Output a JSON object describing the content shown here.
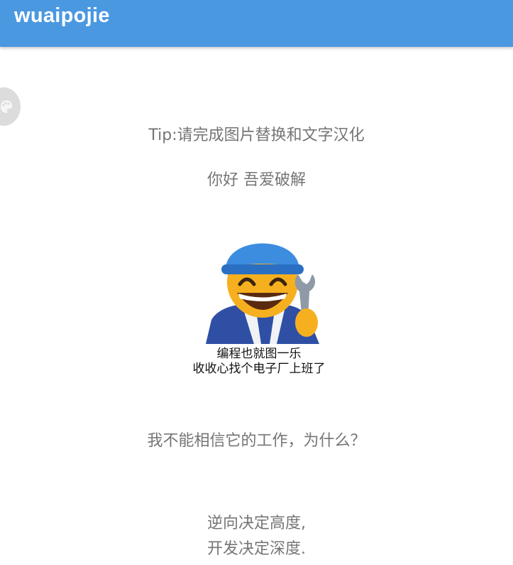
{
  "app_bar": {
    "title": "wuaipojie",
    "color": "#4a98e0"
  },
  "fab": {
    "icon": "palette-icon"
  },
  "content": {
    "tip": "Tip:请完成图片替换和文字汉化",
    "greeting": "你好 吾爱破解",
    "meme": {
      "image": "mechanic-emoji-with-wrench",
      "caption_line1": "编程也就图一乐",
      "caption_line2": "收收心找个电子厂上班了"
    },
    "question": "我不能相信它的工作，为什么？",
    "quote_line1": "逆向决定高度,",
    "quote_line2": "开发决定深度."
  }
}
